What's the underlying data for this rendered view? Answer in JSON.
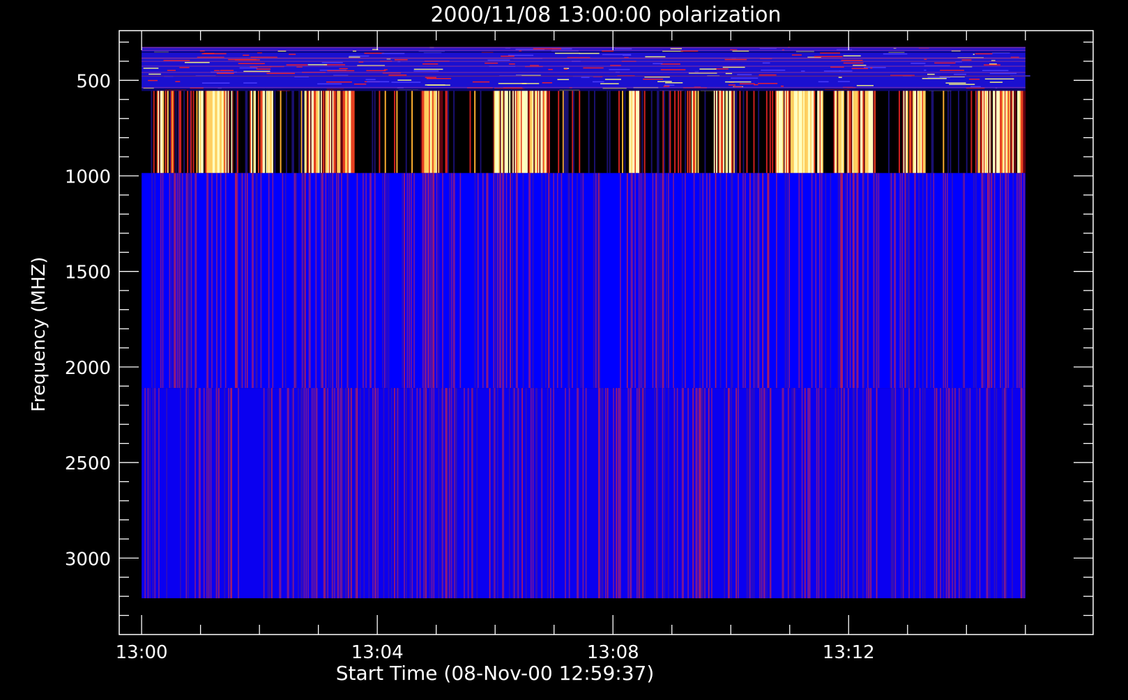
{
  "chart_data": {
    "type": "heatmap",
    "title": "2000/11/08 13:00:00 polarization",
    "xlabel": "Start Time (08-Nov-00 12:59:37)",
    "ylabel": "Frequency (MHZ)",
    "x_unit": "minutes after 13:00",
    "xlim": [
      -0.38,
      16.15
    ],
    "ylim": [
      3400,
      240
    ],
    "x_ticks": [
      {
        "value": 0,
        "label": "13:00"
      },
      {
        "value": 4,
        "label": "13:04"
      },
      {
        "value": 8,
        "label": "13:08"
      },
      {
        "value": 12,
        "label": "13:12"
      }
    ],
    "y_ticks": [
      {
        "value": 500,
        "label": "500"
      },
      {
        "value": 1000,
        "label": "1000"
      },
      {
        "value": 1500,
        "label": "1500"
      },
      {
        "value": 2000,
        "label": "2000"
      },
      {
        "value": 2500,
        "label": "2500"
      },
      {
        "value": 3000,
        "label": "3000"
      }
    ],
    "data_time_range": [
      0,
      15
    ],
    "bands": [
      {
        "freq_range": [
          325,
          555
        ],
        "pattern": "noise",
        "dominant_color": "#1a10d0"
      },
      {
        "freq_range": [
          555,
          985
        ],
        "pattern": "bursts",
        "dominant_color": "#000000"
      },
      {
        "freq_range": [
          985,
          2110
        ],
        "pattern": "stripes",
        "dominant_color": "#0000ff"
      },
      {
        "freq_range": [
          2110,
          3210
        ],
        "pattern": "stripes",
        "dominant_color": "#0a00f0"
      }
    ],
    "burst_intervals_minutes": [
      [
        0.25,
        0.45
      ],
      [
        0.95,
        1.55
      ],
      [
        1.82,
        2.22
      ],
      [
        2.75,
        3.6
      ],
      [
        4.7,
        5.1
      ],
      [
        5.95,
        6.9
      ],
      [
        8.25,
        8.45
      ],
      [
        9.25,
        9.45
      ],
      [
        9.7,
        10.05
      ],
      [
        10.75,
        11.55
      ],
      [
        11.75,
        12.45
      ],
      [
        12.9,
        13.3
      ],
      [
        14.2,
        15.0
      ]
    ],
    "grid": false,
    "legend": "none",
    "colors": {
      "background": "#000000",
      "axes": "#ffffff"
    }
  }
}
